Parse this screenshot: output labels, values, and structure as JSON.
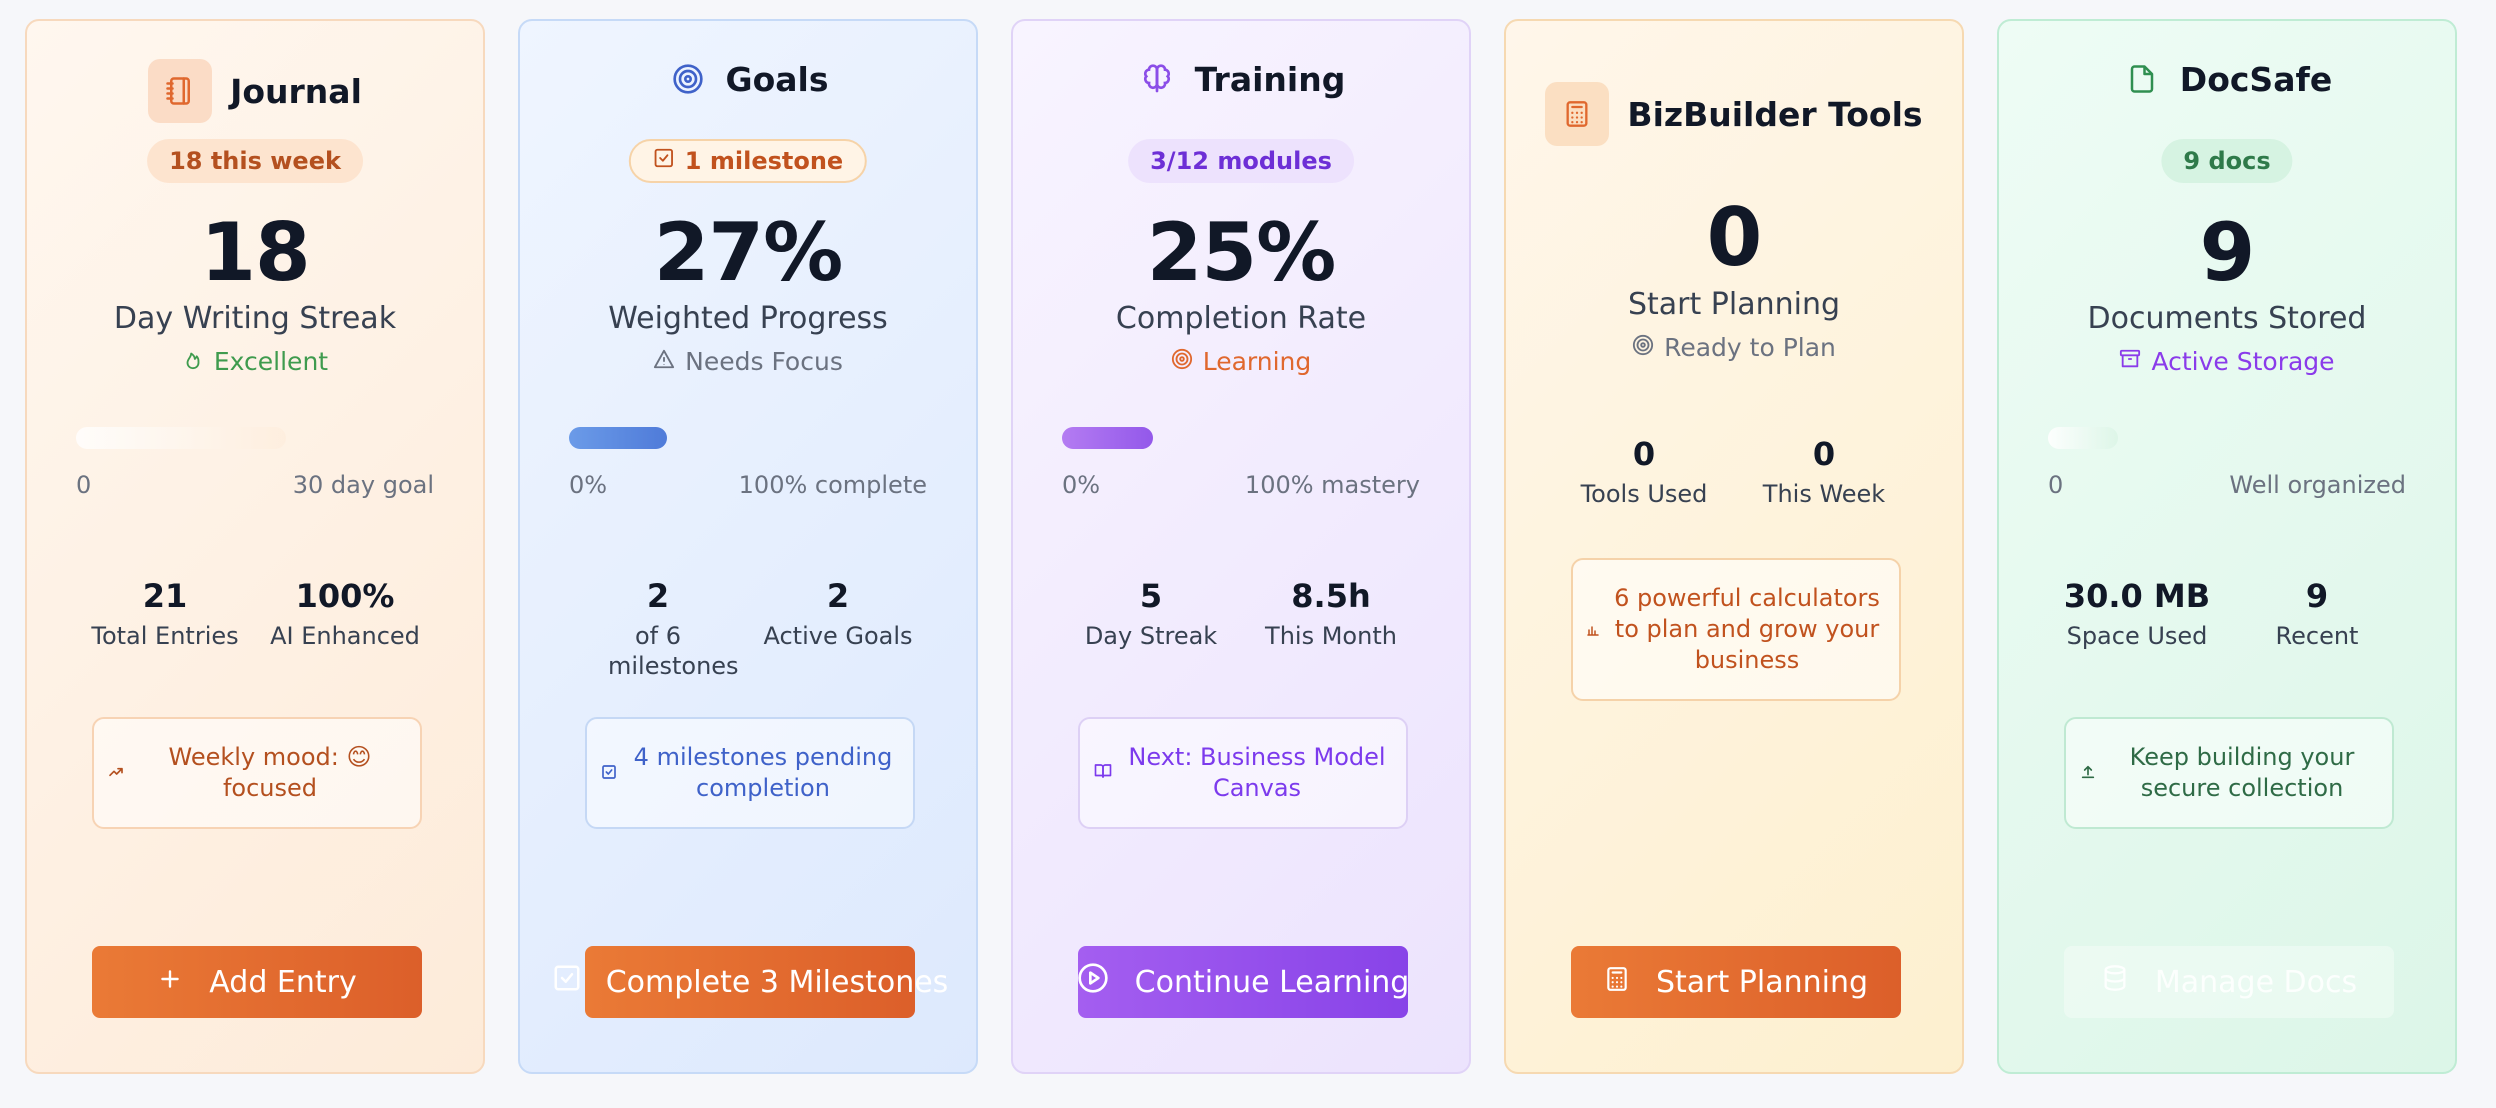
{
  "colors": {
    "orange": "#e0682e",
    "blue": "#4f7bd9",
    "purple": "#7c3aed",
    "green": "#2f8f50"
  },
  "journal": {
    "title": "Journal",
    "badge": "18 this week",
    "value": "18",
    "label": "Day Writing Streak",
    "status": "Excellent",
    "progress_fraction": 0,
    "range_start": "0",
    "range_end": "30 day goal",
    "stat1_value": "21",
    "stat1_label": "Total Entries",
    "stat2_value": "100%",
    "stat2_label": "AI Enhanced",
    "note": "Weekly mood: 😊 focused",
    "button": "Add Entry"
  },
  "goals": {
    "title": "Goals",
    "badge": "1 milestone",
    "value": "27%",
    "label": "Weighted Progress",
    "status": "Needs Focus",
    "progress_fraction": 0.27,
    "range_start": "0%",
    "range_end": "100% complete",
    "stat1_value": "2",
    "stat1_label": "of 6 milestones",
    "stat2_value": "2",
    "stat2_label": "Active Goals",
    "note": "4 milestones pending completion",
    "button": "Complete 3 Milestones"
  },
  "training": {
    "title": "Training",
    "badge": "3/12 modules",
    "value": "25%",
    "label": "Completion Rate",
    "status": "Learning",
    "progress_fraction": 0.25,
    "range_start": "0%",
    "range_end": "100% mastery",
    "stat1_value": "5",
    "stat1_label": "Day Streak",
    "stat2_value": "8.5h",
    "stat2_label": "This Month",
    "note": "Next: Business Model Canvas",
    "button": "Continue Learning"
  },
  "biz": {
    "title": "BizBuilder Tools",
    "value": "0",
    "label": "Start Planning",
    "status": "Ready to Plan",
    "stat1_value": "0",
    "stat1_label": "Tools Used",
    "stat2_value": "0",
    "stat2_label": "This Week",
    "note": "6 powerful calculators to plan and grow your business",
    "button": "Start Planning"
  },
  "docs": {
    "title": "DocSafe",
    "badge": "9 docs",
    "value": "9",
    "label": "Documents Stored",
    "status": "Active Storage",
    "progress_fraction": 0,
    "range_start": "0",
    "range_end": "Well organized",
    "stat1_value": "30.0 MB",
    "stat1_label": "Space Used",
    "stat2_value": "9",
    "stat2_label": "Recent",
    "note": "Keep building your secure collection",
    "button": "Manage Docs"
  }
}
